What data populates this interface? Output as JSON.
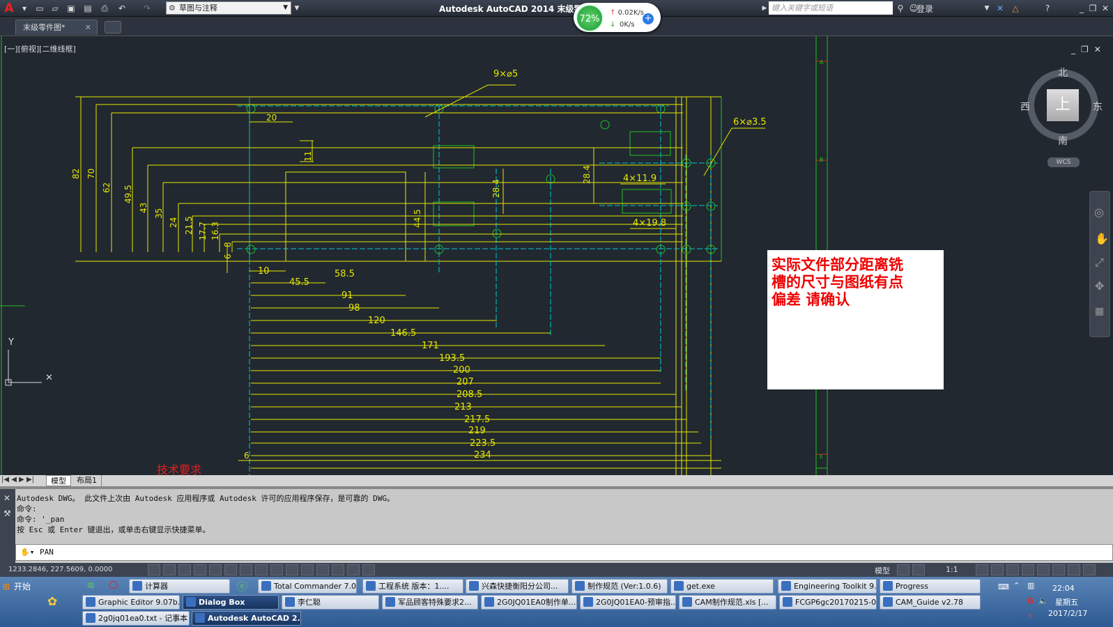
{
  "titlebar": {
    "workspace": "草图与注释",
    "title": "Autodesk AutoCAD 2014    末级零件图.dwg",
    "search_placeholder": "键入关键字或短语",
    "login": "登录"
  },
  "netmon": {
    "percent": "72%",
    "up": "0.02K/s",
    "down": "0K/s"
  },
  "doctab": {
    "label": "末级零件图*"
  },
  "viewport": {
    "label": "[一][俯视][二维线框]"
  },
  "viewcube": {
    "north": "北",
    "south": "南",
    "east": "东",
    "west": "西",
    "top": "上",
    "wcs": "WCS"
  },
  "drawing": {
    "vertical_dims": [
      "82",
      "70",
      "62",
      "49.5",
      "43",
      "35",
      "24",
      "21.5",
      "17.7",
      "16.3",
      "8",
      "6"
    ],
    "horizontal_dims": [
      "10",
      "45.5",
      "58.5",
      "91",
      "98",
      "120",
      "146.5",
      "171",
      "193.5",
      "200",
      "207",
      "208.5",
      "213",
      "217.5",
      "219",
      "223.5",
      "234"
    ],
    "top_dim": "20",
    "left_bottom": "6",
    "small": "11",
    "callouts": {
      "holes_a": "9×⌀5",
      "holes_b": "6×⌀3.5",
      "slot_a": "4×11.9",
      "slot_b": "4×19.8"
    },
    "mid_dims": [
      "28.4",
      "28.4",
      "44.5"
    ],
    "bottom_note": "技术要求",
    "grid_letters": [
      "A",
      "B",
      "C",
      "D",
      "E"
    ]
  },
  "note": {
    "line1": "实际文件部分距离铣",
    "line2": "槽的尺寸与图纸有点",
    "line3": "偏差    请确认"
  },
  "layouttabs": {
    "model": "模型",
    "layout1": "布局1"
  },
  "cmd": {
    "lines": [
      "Autodesk DWG。  此文件上次由 Autodesk 应用程序或 Autodesk 许可的应用程序保存，是可靠的 DWG。",
      "命令:",
      "命令: '_pan",
      "按 Esc 或 Enter 键退出，或单击右键显示快捷菜单。"
    ],
    "input": "PAN"
  },
  "status": {
    "coords": "1233.2846, 227.5609, 0.0000",
    "model": "模型",
    "scale": "1:1"
  },
  "taskbar": {
    "start": "开始",
    "row1": [
      "计算器",
      "Total Commander 7.0 ...",
      "工程系统  版本：1....",
      "兴森快捷衡阳分公司...",
      "制作规范 (Ver:1.0.6)",
      "get.exe",
      "Engineering Toolkit 9....",
      "Progress"
    ],
    "row2": [
      "Graphic Editor 9.07b...",
      "Dialog Box",
      "李仁聪",
      "军品顾客特殊要求2...",
      "2G0JQ01EA0制作单....",
      "2G0JQ01EA0-预审指...",
      "CAM制作规范.xls  [...",
      "FCGP6gc20170215-0...",
      "CAM_Guide v2.78"
    ],
    "row3": [
      "2g0jq01ea0.txt - 记事本",
      "Autodesk AutoCAD 2..."
    ],
    "time": "22:04",
    "day": "星期五",
    "date": "2017/2/17"
  },
  "colors": {
    "dim": "#e8e800",
    "green": "#22c022",
    "cyan": "#00c8d8",
    "red": "#e02020"
  }
}
